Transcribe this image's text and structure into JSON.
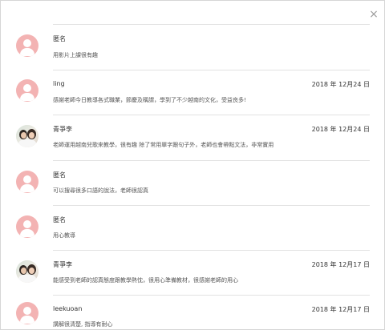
{
  "close_label": "×",
  "reviews": [
    {
      "name": "匿名",
      "date": "",
      "text": "用影片上課很有趣",
      "avatar": "default"
    },
    {
      "name": "ling",
      "date": "2018 年 12月24 日",
      "text": "感謝老師今日教導各式職業，節慶及稱謂，學到了不少越南的文化，受益良多!",
      "avatar": "default"
    },
    {
      "name": "青爭李",
      "date": "2018 年 12月24 日",
      "text": "老師運用越南兒歌來教學，很有趣 除了常用單字跟句子外，老師也會帶點文法，非常實用",
      "avatar": "photo"
    },
    {
      "name": "匿名",
      "date": "",
      "text": "可以搜尋很多口語的說法，老師很認真",
      "avatar": "default"
    },
    {
      "name": "匿名",
      "date": "",
      "text": "用心教導",
      "avatar": "default"
    },
    {
      "name": "青爭李",
      "date": "2018 年 12月17 日",
      "text": "能感受到老師的認真態度跟教學熱忱，很用心準備教材，很感謝老師的用心",
      "avatar": "photo"
    },
    {
      "name": "leekuoan",
      "date": "2018 年 12月17 日",
      "text": "講解很清楚, 指導有耐心",
      "avatar": "default"
    }
  ]
}
